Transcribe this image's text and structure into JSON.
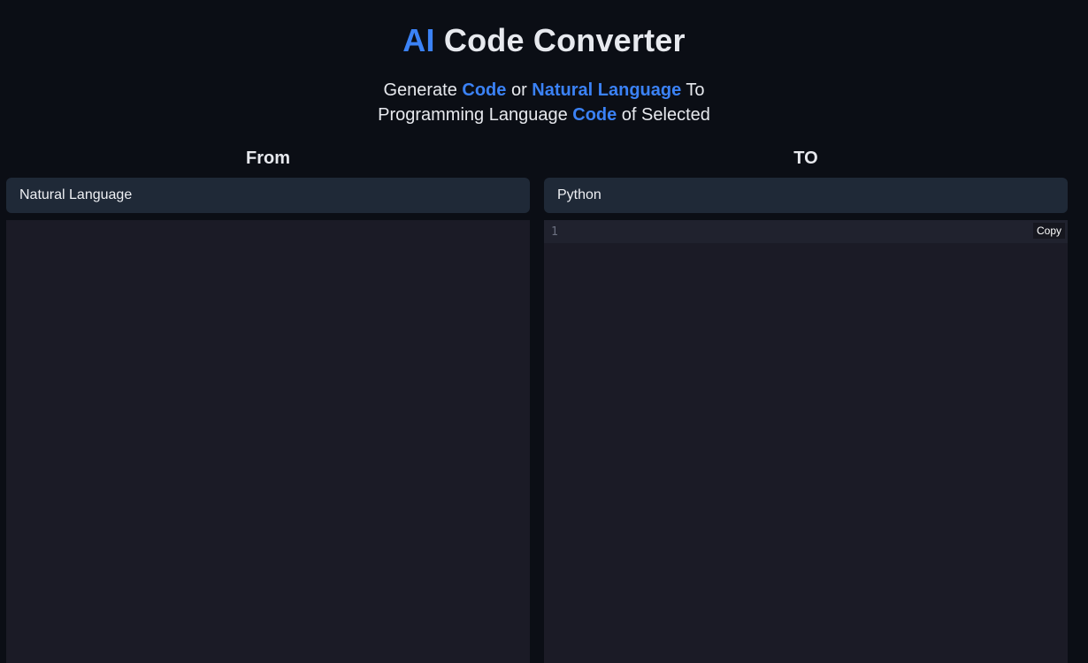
{
  "header": {
    "title_accent": "AI",
    "title_rest": " Code Converter",
    "subtitle": {
      "p1": "Generate ",
      "hl1": "Code",
      "p2": " or ",
      "hl2": "Natural Language",
      "p3": " To",
      "p4": "Programming Language ",
      "hl3": "Code",
      "p5": " of Selected"
    }
  },
  "from_panel": {
    "heading": "From",
    "selected_language": "Natural Language",
    "input_value": ""
  },
  "to_panel": {
    "heading": "TO",
    "selected_language": "Python",
    "line_number": "1",
    "copy_label": "Copy"
  },
  "colors": {
    "accent": "#3b82f6",
    "background": "#0b0e15",
    "select_bg": "#1f2937",
    "editor_bg": "#1b1b26"
  }
}
